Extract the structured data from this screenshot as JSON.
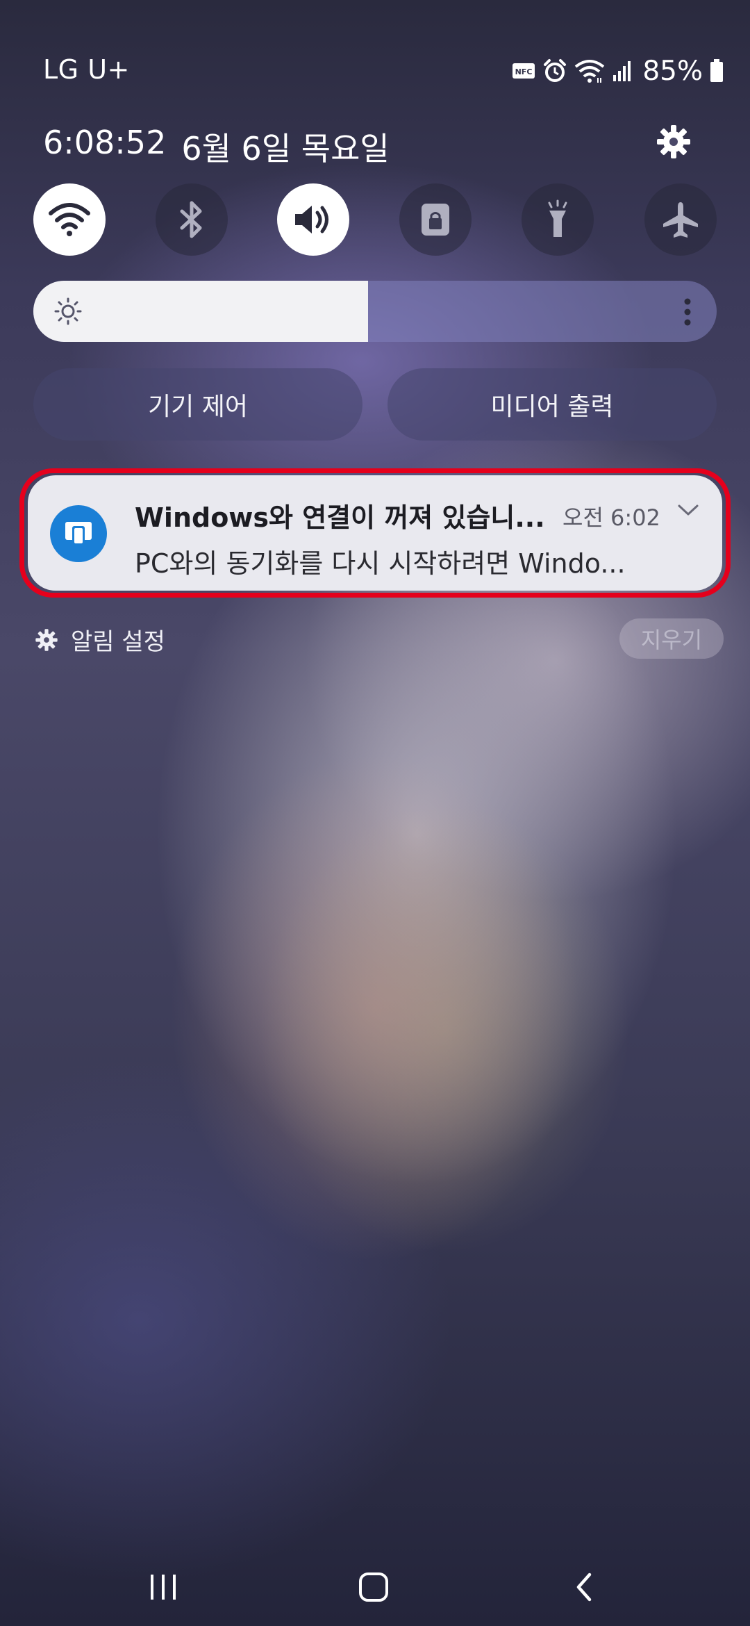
{
  "status_bar": {
    "carrier": "LG U+",
    "battery_percent": "85%",
    "icons": [
      "nfc-icon",
      "alarm-icon",
      "wifi-signal-icon",
      "cell-signal-icon",
      "battery-icon"
    ]
  },
  "header": {
    "time": "6:08:52",
    "date": "6월 6일 목요일",
    "settings_icon": "gear-icon"
  },
  "quick_settings": [
    {
      "name": "wifi",
      "icon": "wifi-icon",
      "on": true
    },
    {
      "name": "bluetooth",
      "icon": "bluetooth-icon",
      "on": false
    },
    {
      "name": "sound",
      "icon": "sound-icon",
      "on": true
    },
    {
      "name": "rotation-lock",
      "icon": "lock-icon",
      "on": false
    },
    {
      "name": "flashlight",
      "icon": "flashlight-icon",
      "on": false
    },
    {
      "name": "airplane-mode",
      "icon": "airplane-icon",
      "on": false
    }
  ],
  "brightness": {
    "level": 0.49,
    "icon": "sun-icon",
    "more_icon": "more-vertical-icon"
  },
  "buttons": {
    "device_control": "기기 제어",
    "media_output": "미디어 출력"
  },
  "notification": {
    "app_icon": "phone-link-icon",
    "title": "Windows와 연결이 꺼져 있습니...",
    "time": "오전 6:02",
    "body": "PC와의 동기화를 다시 시작하려면 Windo...",
    "expand_icon": "chevron-down-icon",
    "highlight_color": "#e5001c",
    "app_color": "#1a7fd6"
  },
  "footer": {
    "settings_label": "알림 설정",
    "clear_label": "지우기"
  },
  "nav": {
    "recents_icon": "recents-icon",
    "home_icon": "home-icon",
    "back_icon": "back-icon"
  }
}
